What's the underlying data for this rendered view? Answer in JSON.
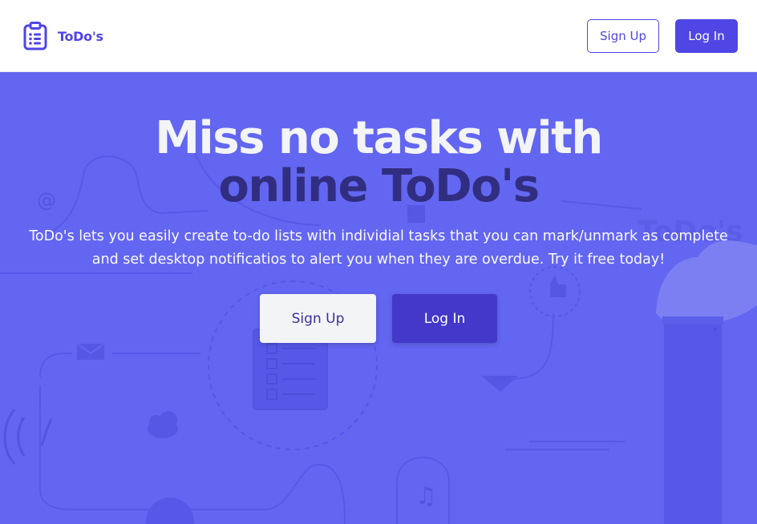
{
  "navbar": {
    "brand_icon": "clipboard-list-icon",
    "brand_name": "ToDo's",
    "signup_label": "Sign Up",
    "login_label": "Log In"
  },
  "hero": {
    "headline_line1": "Miss no tasks with",
    "headline_line2": "online ToDo's",
    "description": "ToDo's lets you easily create to-do lists with individial tasks that you can mark/unmark as complete and set desktop notificatios to alert you when they are overdue. Try it free today!",
    "signup_label": "Sign Up",
    "login_label": "Log In",
    "background_watermark": "ToDo's"
  },
  "colors": {
    "brand": "#4f46e5",
    "hero_background": "#6366f1",
    "headline_accent": "#312e81",
    "headline_light": "#f3f4f6",
    "cta_dark": "#4338ca"
  }
}
